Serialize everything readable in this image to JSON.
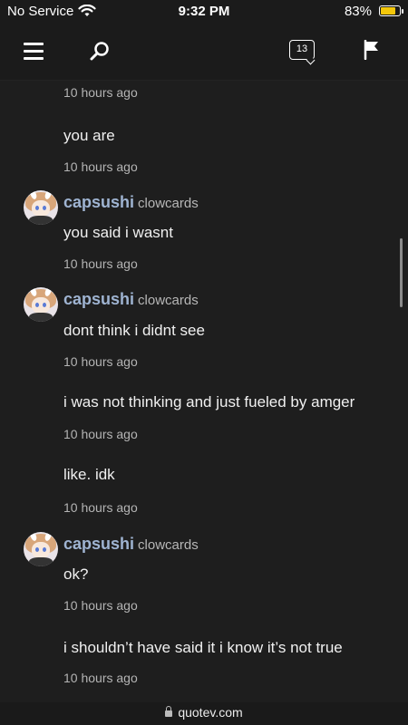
{
  "status_bar": {
    "carrier": "No Service",
    "time": "9:32 PM",
    "battery_percent": "83%",
    "battery_level": 0.83,
    "battery_color": "#f4c70a"
  },
  "nav": {
    "menu_icon": "hamburger-menu",
    "search_icon": "search",
    "notification_count": "13",
    "flag_icon": "flag"
  },
  "feed": [
    {
      "type": "time",
      "text": "10 hours ago"
    },
    {
      "type": "message",
      "text": "you are"
    },
    {
      "type": "time",
      "text": "10 hours ago"
    },
    {
      "type": "author",
      "name": "capsushi",
      "handle": "clowcards"
    },
    {
      "type": "message",
      "text": "you said i wasnt"
    },
    {
      "type": "time",
      "text": "10 hours ago"
    },
    {
      "type": "author",
      "name": "capsushi",
      "handle": "clowcards"
    },
    {
      "type": "message",
      "text": "dont think i didnt see"
    },
    {
      "type": "time",
      "text": "10 hours ago"
    },
    {
      "type": "message",
      "text": "i was not thinking and just fueled by amger"
    },
    {
      "type": "time",
      "text": "10 hours ago"
    },
    {
      "type": "message",
      "text": "like. idk"
    },
    {
      "type": "time",
      "text": "10 hours ago"
    },
    {
      "type": "author",
      "name": "capsushi",
      "handle": "clowcards"
    },
    {
      "type": "message",
      "text": "ok?"
    },
    {
      "type": "time",
      "text": "10 hours ago"
    },
    {
      "type": "message",
      "text": "i shouldn’t have said it i know it’s not true"
    },
    {
      "type": "time",
      "text": "10 hours ago"
    }
  ],
  "browser": {
    "url": "quotev.com"
  },
  "colors": {
    "background": "#1e1e1e",
    "author_name": "#9fb4d2"
  }
}
